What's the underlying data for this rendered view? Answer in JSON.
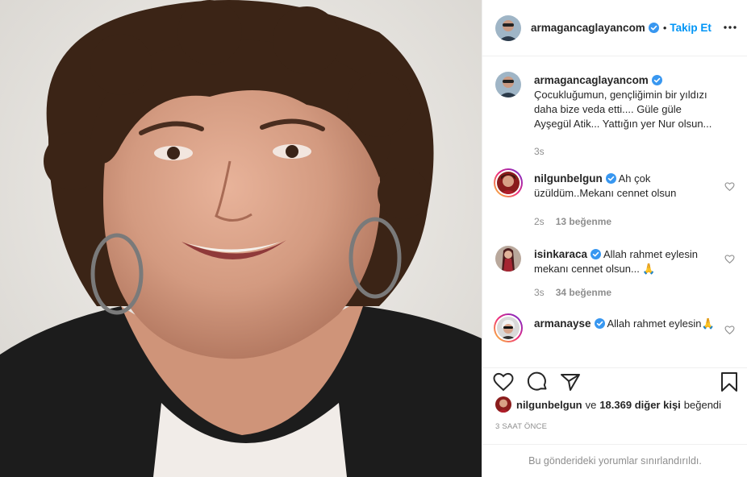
{
  "post": {
    "image_alt": "Portrait of a smiling woman with short curly brown hair and hoop earrings"
  },
  "header": {
    "username": "armagancaglayancom",
    "dot": "•",
    "follow_label": "Takip Et",
    "more_icon": "more-horizontal-icon"
  },
  "caption": {
    "username": "armagancaglayancom",
    "text": "Çocukluğumun, gençliğimin bir yıldızı daha bize veda etti.... Güle güle Ayşegül Atik... Yattığın yer Nur olsun...",
    "time": "3s"
  },
  "comments": [
    {
      "username": "nilgunbelgun",
      "text": "Ah çok üzüldüm..Mekanı cennet olsun",
      "time": "2s",
      "likes": "13 beğenme"
    },
    {
      "username": "isinkaraca",
      "text": "Allah rahmet eylesin mekanı cennet olsun... 🙏",
      "time": "3s",
      "likes": "34 beğenme"
    },
    {
      "username": "armanayse",
      "text": "Allah rahmet eylesin🙏",
      "time": "",
      "likes": ""
    }
  ],
  "likes": {
    "first_user": "nilgunbelgun",
    "connector": "ve",
    "others": "18.369 diğer kişi",
    "suffix": "beğendi"
  },
  "time_ago": "3 SAAT ÖNCE",
  "comments_restricted": "Bu gönderideki yorumlar sınırlandırıldı.",
  "colors": {
    "accent": "#0095f6",
    "muted": "#8e8e8e",
    "text": "#262626",
    "border": "#efefef"
  }
}
